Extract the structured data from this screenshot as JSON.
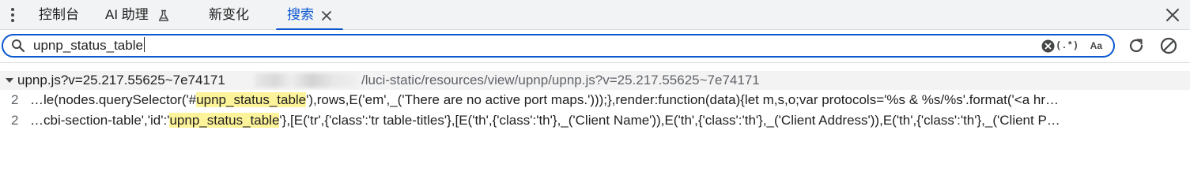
{
  "tabs": [
    {
      "label": "控制台"
    },
    {
      "label": "AI 助理"
    },
    {
      "label": "新变化"
    },
    {
      "label": "搜索"
    }
  ],
  "search": {
    "query": "upnp_status_table",
    "regex_label": "(.*)",
    "case_label": "Aa"
  },
  "results": {
    "file_name": "upnp.js?v=25.217.55625~7e74171",
    "file_path": "/luci-static/resources/view/upnp/upnp.js?v=25.217.55625~7e74171",
    "matches": [
      {
        "line": "2",
        "before": "…le(nodes.querySelector('#",
        "match": "upnp_status_table",
        "after": "'),rows,E('em',_('There are no active port maps.')));},render:function(data){let m,s,o;var protocols='%s & %s/%s'.format('<a hr…"
      },
      {
        "line": "2",
        "before": "…cbi-section-table','id':'",
        "match": "upnp_status_table",
        "after": "'},[E('tr',{'class':'tr table-titles'},[E('th',{'class':'th'},_('Client Name')),E('th',{'class':'th'},_('Client Address')),E('th',{'class':'th'},_('Client P…"
      }
    ]
  },
  "colors": {
    "accent": "#0b57d0",
    "highlight": "#fdf39a",
    "tabbar_bg": "#f1f3f4"
  }
}
